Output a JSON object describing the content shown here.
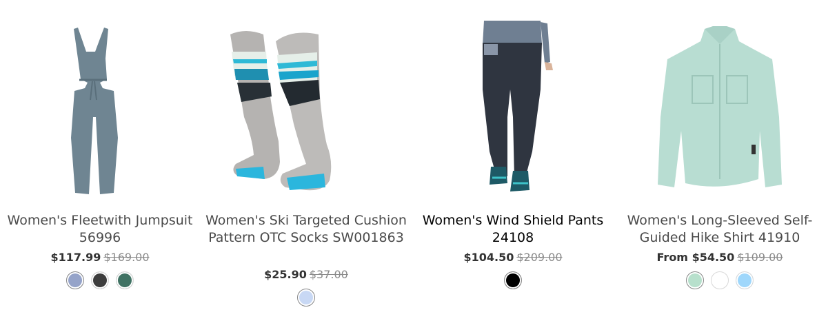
{
  "products": [
    {
      "title": "Women's Fleetwith Jumpsuit 56996",
      "price_prefix": "",
      "price": "$117.99",
      "original_price": "$169.00",
      "image": "jumpsuit",
      "swatches": [
        "#95a3c9",
        "#3d3d3d",
        "#3f7263"
      ]
    },
    {
      "title": "Women's Ski Targeted Cushion Pattern OTC Socks SW001863",
      "price_prefix": "",
      "price": "$25.90",
      "original_price": "$37.00",
      "image": "socks",
      "swatches": [
        "#c8d8f4"
      ]
    },
    {
      "title": "Women's Wind Shield Pants 24108",
      "price_prefix": "",
      "price": "$104.50",
      "original_price": "$209.00",
      "image": "pants",
      "swatches": [
        "#000000"
      ]
    },
    {
      "title": "Women's Long-Sleeved Self-Guided Hike Shirt 41910",
      "price_prefix": "From",
      "price": "$54.50",
      "original_price": "$109.00",
      "image": "shirt",
      "swatches": [
        "#b7e0cc",
        "#ffffff",
        "#9fd7fb"
      ]
    }
  ]
}
